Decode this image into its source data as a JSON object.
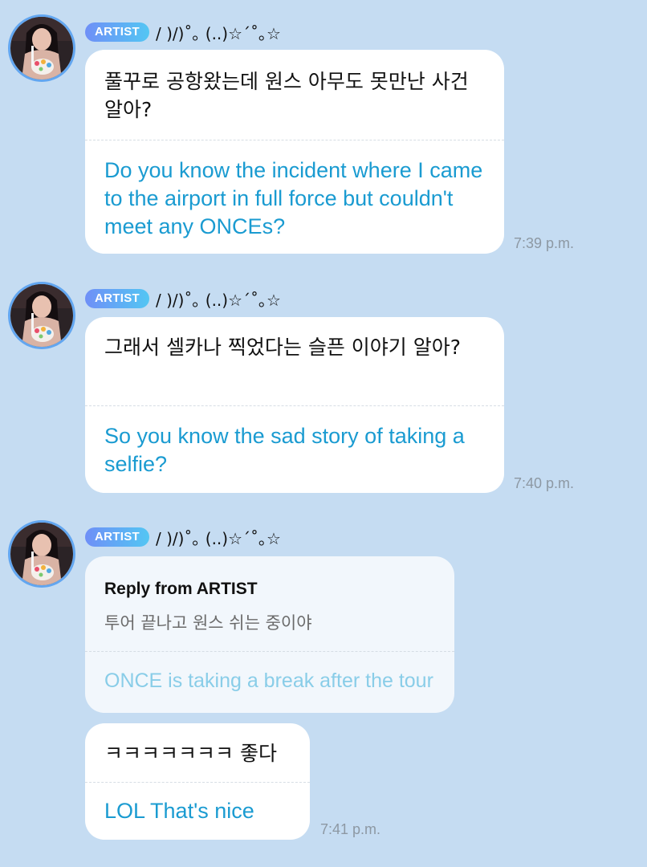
{
  "messages": [
    {
      "badge": "ARTIST",
      "sender_name": "/ )/)˚｡ (..)☆´˚｡☆",
      "korean": "풀꾸로 공항왔는데 원스 아무도 못만난 사건 알아?",
      "english": "Do you know the incident where I came to the airport in full force but couldn't meet any ONCEs?",
      "time": "7:39 p.m."
    },
    {
      "badge": "ARTIST",
      "sender_name": "/ )/)˚｡ (..)☆´˚｡☆",
      "korean": "그래서 셀카나 찍었다는 슬픈 이야기 알아?",
      "english": "So you know the sad story of taking a selfie?",
      "time": "7:40 p.m."
    },
    {
      "badge": "ARTIST",
      "sender_name": "/ )/)˚｡ (..)☆´˚｡☆",
      "reply": {
        "title": "Reply from ARTIST",
        "korean": "투어 끝나고 원스 쉬는 중이야",
        "english": "ONCE is taking a break after the tour"
      },
      "korean": "ㅋㅋㅋㅋㅋㅋㅋ 좋다",
      "english": "LOL That's nice",
      "time": "7:41 p.m."
    }
  ],
  "colors": {
    "background": "#c5dcf2",
    "translation_text": "#1a9bd1",
    "badge_gradient_start": "#6f8ff7",
    "badge_gradient_end": "#53c6f3",
    "avatar_ring": "#62a6f0",
    "timestamp": "#8d98a3"
  },
  "icons": {
    "avatar": "artist-profile-photo"
  }
}
